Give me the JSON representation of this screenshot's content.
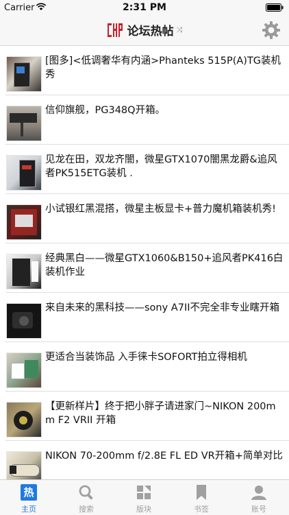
{
  "status_bar": {
    "carrier": "Carrier",
    "time": "2:31 PM"
  },
  "nav": {
    "logo_icon": "chiphell-logo",
    "title": "论坛热帖",
    "title_suffix_icon": "shuffle-icon",
    "settings_icon": "gear-icon"
  },
  "posts": [
    {
      "title": "[图多]<低调奢华有内涵>Phanteks 515P(A)TG装机秀"
    },
    {
      "title": "信仰旗舰，PG348Q开箱。"
    },
    {
      "title": "见龙在田，双龙齐闇，微星GTX1070闇黑龙爵&追风者PK515ETG装机 ."
    },
    {
      "title": "小试银红黑混搭，微星主板显卡+普力魔机箱装机秀!"
    },
    {
      "title": "经典黑白——微星GTX1060&B150+追风者PK416白 装机作业"
    },
    {
      "title": "来自未来的黑科技——sony A7II不完全非专业瞎开箱"
    },
    {
      "title": "更适合当装饰品 入手徕卡SOFORT拍立得相机"
    },
    {
      "title": "【更新样片】终于把小胖子请进家门~NIKON 200mm F2 VRII 开箱"
    },
    {
      "title": "NIKON 70-200mm f/2.8E FL ED VR开箱+简单对比"
    }
  ],
  "tabs": [
    {
      "label": "主页",
      "icon": "hot-icon",
      "glyph": "热"
    },
    {
      "label": "搜索",
      "icon": "search-icon"
    },
    {
      "label": "版块",
      "icon": "sections-icon"
    },
    {
      "label": "书签",
      "icon": "bookmark-icon"
    },
    {
      "label": "账号",
      "icon": "account-icon"
    }
  ],
  "colors": {
    "accent": "#1f7adf",
    "logo_red": "#c8202a",
    "inactive": "#a0a0a0"
  }
}
